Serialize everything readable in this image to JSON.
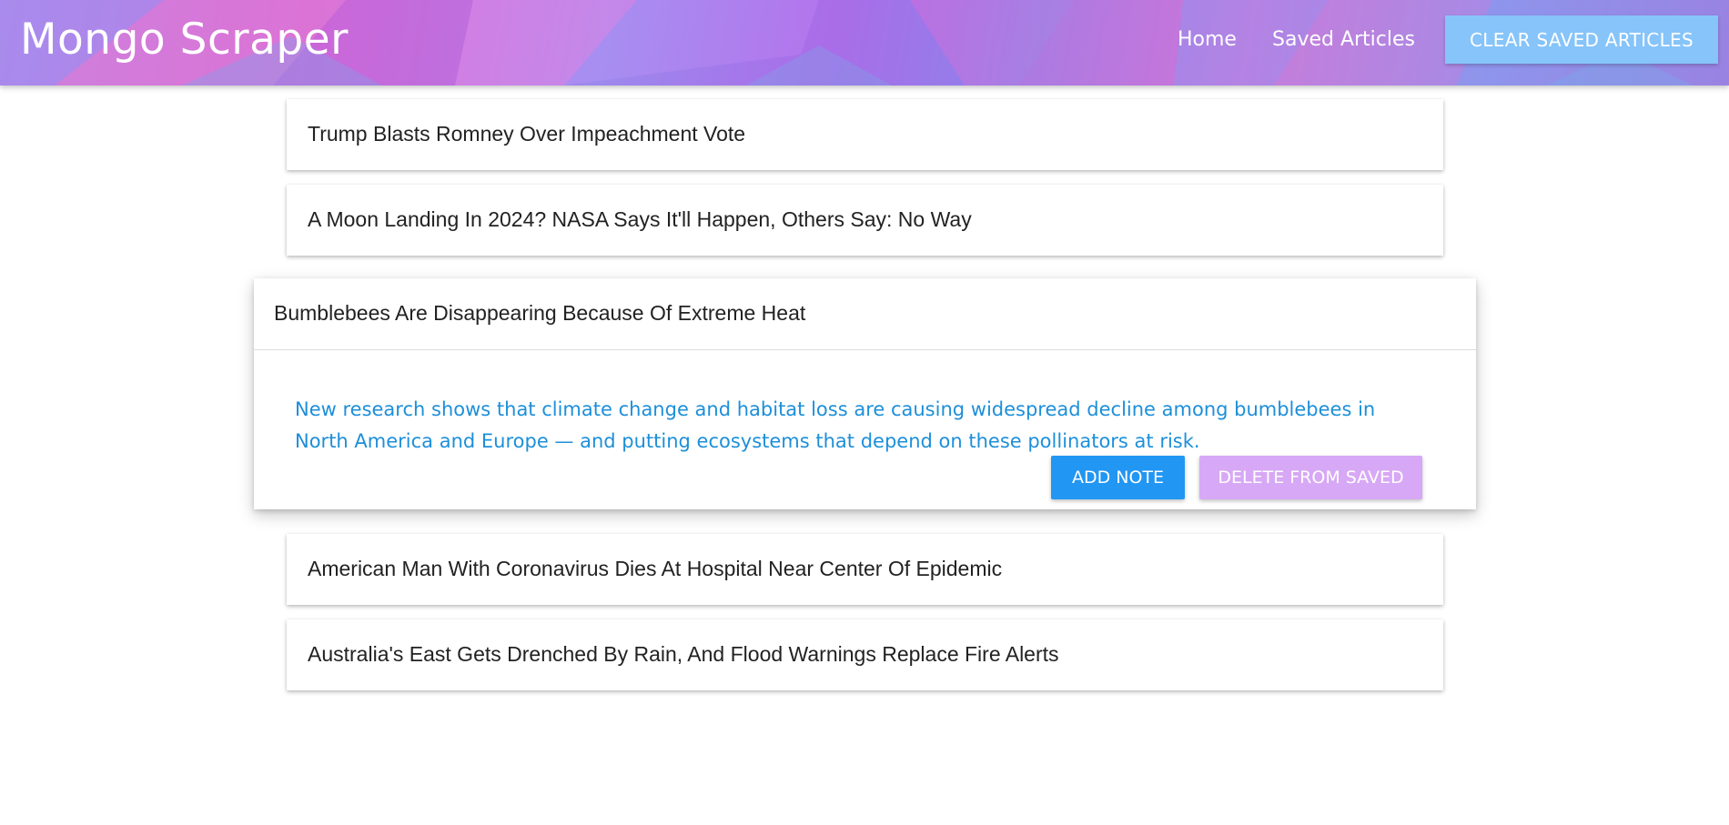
{
  "navbar": {
    "brand": "Mongo Scraper",
    "links": [
      {
        "label": "Home"
      },
      {
        "label": "Saved Articles"
      }
    ],
    "clear_button_label": "CLEAR SAVED ARTICLES",
    "colors": {
      "button": "#86c4fa"
    }
  },
  "articles": [
    {
      "title": "Trump Blasts Romney Over Impeachment Vote"
    },
    {
      "title": "A Moon Landing In 2024? NASA Says It'll Happen, Others Say: No Way"
    },
    {
      "title": "Bumblebees Are Disappearing Because Of Extreme Heat",
      "expanded": true,
      "summary": "New research shows that climate change and habitat loss are causing widespread decline among bumblebees in North America and Europe — and putting ecosystems that depend on these pollinators at risk.",
      "add_note_label": "ADD NOTE",
      "delete_label": "DELETE FROM SAVED"
    },
    {
      "title": "American Man With Coronavirus Dies At Hospital Near Center Of Epidemic"
    },
    {
      "title": "Australia's East Gets Drenched By Rain, And Flood Warnings Replace Fire Alerts"
    }
  ],
  "colors": {
    "summary_text": "#1d8fd9",
    "add_note_button": "#2196f3",
    "delete_button": "#d7a8f6"
  }
}
